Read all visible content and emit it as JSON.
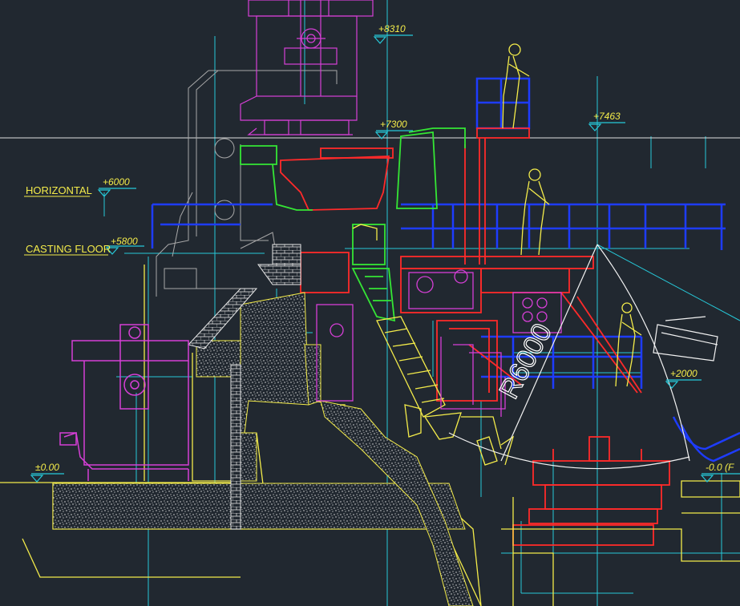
{
  "drawing": {
    "background": "#212830",
    "colors": {
      "cyan": "#26c9d9",
      "yellow": "#f4ec4a",
      "magenta": "#d63fd6",
      "red": "#ff2a2a",
      "green": "#35e635",
      "blue": "#1e3cff",
      "white": "#f2f2f2",
      "gray": "#a8a8a8"
    },
    "labels": {
      "horizontal": "HORIZONTAL",
      "casting_floor": "CASTING  FLOOR",
      "radius": "R6000"
    },
    "elevations": {
      "e8310": "+8310",
      "e7300": "+7300",
      "e7463": "+7463",
      "e6000": "+6000",
      "e5800": "+5800",
      "e2000": "+2000",
      "e000": "±0.00",
      "e00": "-0.0  (F"
    }
  }
}
